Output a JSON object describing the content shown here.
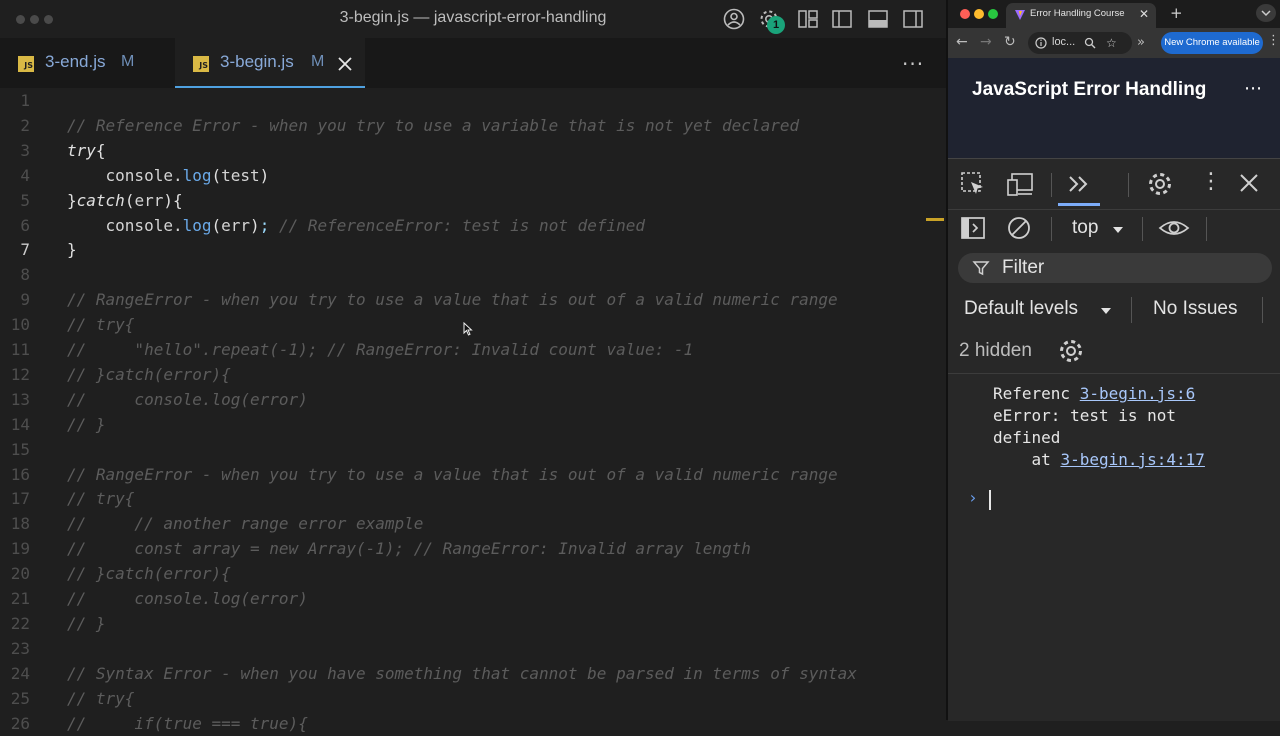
{
  "vscode": {
    "window_title": "3-begin.js — javascript-error-handling",
    "notification_count": "1",
    "tabs": [
      {
        "badge": "JS",
        "label": "3-end.js",
        "modified": "M"
      },
      {
        "badge": "JS",
        "label": "3-begin.js",
        "modified": "M"
      }
    ],
    "active_line": 7,
    "lines": [
      {
        "n": "1",
        "t": ""
      },
      {
        "n": "2",
        "t": "// Reference Error - when you try to use a variable that is not yet declared"
      },
      {
        "n": "3",
        "t": "try{"
      },
      {
        "n": "4",
        "t": "    console.log(test)"
      },
      {
        "n": "5",
        "t": "}catch(err){"
      },
      {
        "n": "6",
        "t": "    console.log(err); // ReferenceError: test is not defined"
      },
      {
        "n": "7",
        "t": "}"
      },
      {
        "n": "8",
        "t": ""
      },
      {
        "n": "9",
        "t": "// RangeError - when you try to use a value that is out of a valid numeric range"
      },
      {
        "n": "10",
        "t": "// try{"
      },
      {
        "n": "11",
        "t": "//     \"hello\".repeat(-1); // RangeError: Invalid count value: -1"
      },
      {
        "n": "12",
        "t": "// }catch(error){"
      },
      {
        "n": "13",
        "t": "//     console.log(error)"
      },
      {
        "n": "14",
        "t": "// }"
      },
      {
        "n": "15",
        "t": ""
      },
      {
        "n": "16",
        "t": "// RangeError - when you try to use a value that is out of a valid numeric range"
      },
      {
        "n": "17",
        "t": "// try{"
      },
      {
        "n": "18",
        "t": "//     // another range error example"
      },
      {
        "n": "19",
        "t": "//     const array = new Array(-1); // RangeError: Invalid array length"
      },
      {
        "n": "20",
        "t": "// }catch(error){"
      },
      {
        "n": "21",
        "t": "//     console.log(error)"
      },
      {
        "n": "22",
        "t": "// }"
      },
      {
        "n": "23",
        "t": ""
      },
      {
        "n": "24",
        "t": "// Syntax Error - when you have something that cannot be parsed in terms of syntax"
      },
      {
        "n": "25",
        "t": "// try{"
      },
      {
        "n": "26",
        "t": "//     if(true === true){"
      }
    ]
  },
  "chrome": {
    "tab_title": "Error Handling Course",
    "address": "loc...",
    "update_button": "New Chrome available",
    "page_title": "JavaScript Error Handling",
    "devtools": {
      "context": "top",
      "filter_placeholder": "Filter",
      "levels": "Default levels",
      "issues": "No Issues",
      "hidden": "2 hidden",
      "output": {
        "line1": "Referenc",
        "line2": "eError: test is not",
        "line3": "defined",
        "line4_prefix": "    at ",
        "link1": "3-begin.js:6",
        "link2": "3-begin.js:4:17"
      },
      "prompt": "›"
    }
  },
  "colors": {
    "comment": "#5c5c5c",
    "function": "#6aa9e8",
    "accent_blue": "#4fa1e0",
    "js_badge": "#d9b945",
    "link": "#a8c7fa"
  }
}
